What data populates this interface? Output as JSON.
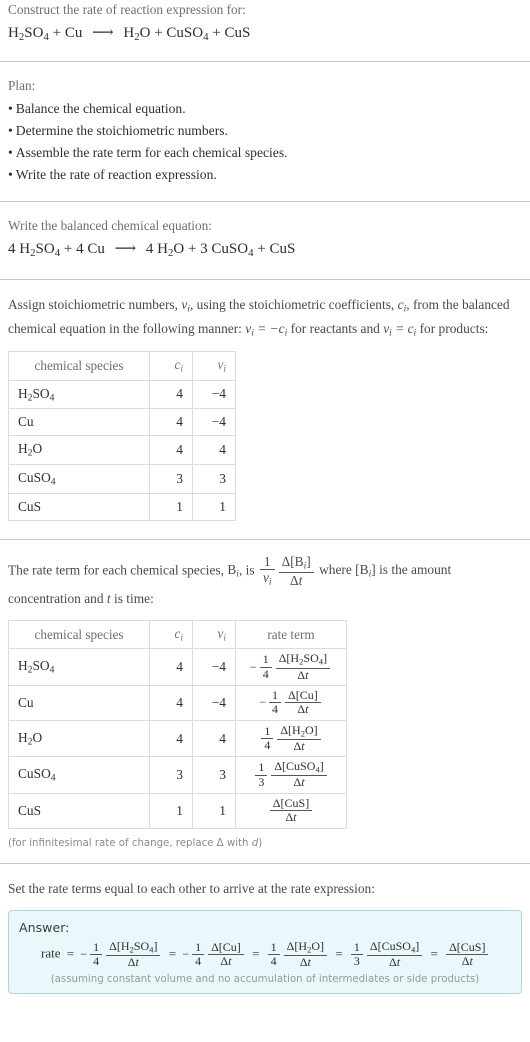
{
  "header": {
    "prompt": "Construct the rate of reaction expression for:",
    "equation": {
      "reactants": [
        "H_2SO_4",
        "Cu"
      ],
      "products": [
        "H_2O",
        "CuSO_4",
        "CuS"
      ],
      "arrow": "⟶"
    }
  },
  "plan": {
    "label": "Plan:",
    "steps": [
      "Balance the chemical equation.",
      "Determine the stoichiometric numbers.",
      "Assemble the rate term for each chemical species.",
      "Write the rate of reaction expression."
    ],
    "bullet": "•"
  },
  "balanced": {
    "label": "Write the balanced chemical equation:",
    "equation_text": "4 H_2SO_4 + 4 Cu ⟶ 4 H_2O + 3 CuSO_4 + CuS",
    "reactants": [
      {
        "coefficient": "4",
        "formula": "H2SO4"
      },
      {
        "coefficient": "4",
        "formula": "Cu"
      }
    ],
    "products": [
      {
        "coefficient": "4",
        "formula": "H2O"
      },
      {
        "coefficient": "3",
        "formula": "CuSO4"
      },
      {
        "coefficient": "",
        "formula": "CuS"
      }
    ]
  },
  "stoich_intro": {
    "part1": "Assign stoichiometric numbers, ",
    "v_i": "ν_i",
    "part2": ", using the stoichiometric coefficients, ",
    "c_i": "c_i",
    "part3": ", from the balanced chemical equation in the following manner: ",
    "rule_reactants": "ν_i = -c_i",
    "part4": " for reactants and ",
    "rule_products": "ν_i = c_i",
    "part5": " for products:"
  },
  "table1": {
    "headers": [
      "chemical species",
      "c_i",
      "ν_i"
    ],
    "rows": [
      {
        "species": "H2SO4",
        "c": "4",
        "v": "-4"
      },
      {
        "species": "Cu",
        "c": "4",
        "v": "-4"
      },
      {
        "species": "H2O",
        "c": "4",
        "v": "4"
      },
      {
        "species": "CuSO4",
        "c": "3",
        "v": "3"
      },
      {
        "species": "CuS",
        "c": "1",
        "v": "1"
      }
    ]
  },
  "rate_intro": {
    "part1": "The rate term for each chemical species, ",
    "b_i": "B_i",
    "part2": ", is ",
    "formula_num1": "1",
    "formula_den1": "ν_i",
    "formula_num2": "Δ[B_i]",
    "formula_den2": "Δt",
    "part3": " where [B_i] is the amount concentration and t is time:"
  },
  "table2": {
    "headers": [
      "chemical species",
      "c_i",
      "ν_i",
      "rate term"
    ],
    "rows": [
      {
        "species": "H2SO4",
        "c": "4",
        "v": "-4",
        "sign": "-",
        "num": "1",
        "den": "4",
        "delta_num": "Δ[H2SO4]",
        "delta_den": "Δt"
      },
      {
        "species": "Cu",
        "c": "4",
        "v": "-4",
        "sign": "-",
        "num": "1",
        "den": "4",
        "delta_num": "Δ[Cu]",
        "delta_den": "Δt"
      },
      {
        "species": "H2O",
        "c": "4",
        "v": "4",
        "sign": "",
        "num": "1",
        "den": "4",
        "delta_num": "Δ[H2O]",
        "delta_den": "Δt"
      },
      {
        "species": "CuSO4",
        "c": "3",
        "v": "3",
        "sign": "",
        "num": "1",
        "den": "3",
        "delta_num": "Δ[CuSO4]",
        "delta_den": "Δt"
      },
      {
        "species": "CuS",
        "c": "1",
        "v": "1",
        "sign": "",
        "num": "",
        "den": "",
        "delta_num": "Δ[CuS]",
        "delta_den": "Δt"
      }
    ]
  },
  "footnote": "(for infinitesimal rate of change, replace Δ with d)",
  "final_intro": "Set the rate terms equal to each other to arrive at the rate expression:",
  "answer": {
    "label": "Answer:",
    "rate_word": "rate",
    "equals": "=",
    "terms": [
      {
        "sign": "-",
        "num": "1",
        "den": "4",
        "delta_num": "Δ[H2SO4]",
        "delta_den": "Δt"
      },
      {
        "sign": "-",
        "num": "1",
        "den": "4",
        "delta_num": "Δ[Cu]",
        "delta_den": "Δt"
      },
      {
        "sign": "",
        "num": "1",
        "den": "4",
        "delta_num": "Δ[H2O]",
        "delta_den": "Δt"
      },
      {
        "sign": "",
        "num": "1",
        "den": "3",
        "delta_num": "Δ[CuSO4]",
        "delta_den": "Δt"
      },
      {
        "sign": "",
        "num": "",
        "den": "",
        "delta_num": "Δ[CuS]",
        "delta_den": "Δt"
      }
    ],
    "note": "(assuming constant volume and no accumulation of intermediates or side products)"
  },
  "colors": {
    "answer_border": "#a8d8e8",
    "answer_background": "#eaf7fb",
    "divider": "#c9c9c9",
    "table_border": "#dcdcdc",
    "muted_text": "#7a7a7a"
  }
}
